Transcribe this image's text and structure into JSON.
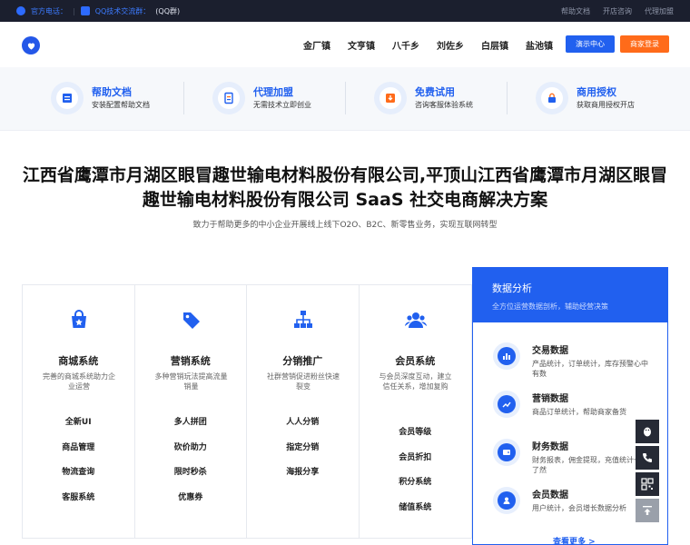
{
  "topbar": {
    "phone_label": "官方电话：",
    "qq_label": "QQ技术交流群：",
    "qq_group": "(QQ群)",
    "links": [
      "帮助文档",
      "开店咨询",
      "代理加盟"
    ]
  },
  "header": {
    "nav": [
      "金厂镇",
      "文亨镇",
      "八千乡",
      "刘佐乡",
      "白层镇",
      "盐池镇"
    ],
    "demo_button": "演示中心",
    "login_button": "商家登录"
  },
  "features": [
    {
      "title": "帮助文档",
      "desc": "安装配置帮助文档"
    },
    {
      "title": "代理加盟",
      "desc": "无需技术立即创业"
    },
    {
      "title": "免费试用",
      "desc": "咨询客服体验系统"
    },
    {
      "title": "商用授权",
      "desc": "获取商用授权开店"
    }
  ],
  "hero": {
    "title_line1": "江西省鹰潭市月湖区眼冒趣世输电材料股份有限公司,平顶山江西省鹰潭市月湖区眼冒",
    "title_line2": "趣世输电材料股份有限公司 SaaS 社交电商解决方案",
    "subtitle": "致力于帮助更多的中小企业开展线上线下O2O、B2C、新零售业务，实现互联网转型"
  },
  "products": [
    {
      "title": "商城系统",
      "desc": "完善的商城系统助力企业运营",
      "items": [
        "全新UI",
        "商品管理",
        "物流查询",
        "客服系统"
      ]
    },
    {
      "title": "营销系统",
      "desc": "多种营销玩法提高流量销量",
      "items": [
        "多人拼团",
        "砍价助力",
        "限时秒杀",
        "优惠券"
      ]
    },
    {
      "title": "分销推广",
      "desc": "社群营销促进粉丝快速裂变",
      "items": [
        "人人分销",
        "指定分销",
        "海报分享"
      ]
    },
    {
      "title": "会员系统",
      "desc": "与会员深度互动，建立信任关系，增加复购",
      "items": [
        "会员等级",
        "会员折扣",
        "积分系统",
        "储值系统"
      ]
    }
  ],
  "panel": {
    "title": "数据分析",
    "subtitle": "全方位运营数据剖析，辅助经营决策",
    "rows": [
      {
        "title": "交易数据",
        "desc": "产品统计，订单统计，库存预警心中有数"
      },
      {
        "title": "营销数据",
        "desc": "商品订单统计，帮助商家备货"
      },
      {
        "title": "财务数据",
        "desc": "财务报表，佣金提现，充值统计一目了然"
      },
      {
        "title": "会员数据",
        "desc": "用户统计，会员增长数据分析"
      }
    ],
    "more": "查看更多 >"
  },
  "colors": {
    "primary": "#2160ef",
    "orange": "#ff6b1a",
    "topbar": "#1b1f2e"
  }
}
